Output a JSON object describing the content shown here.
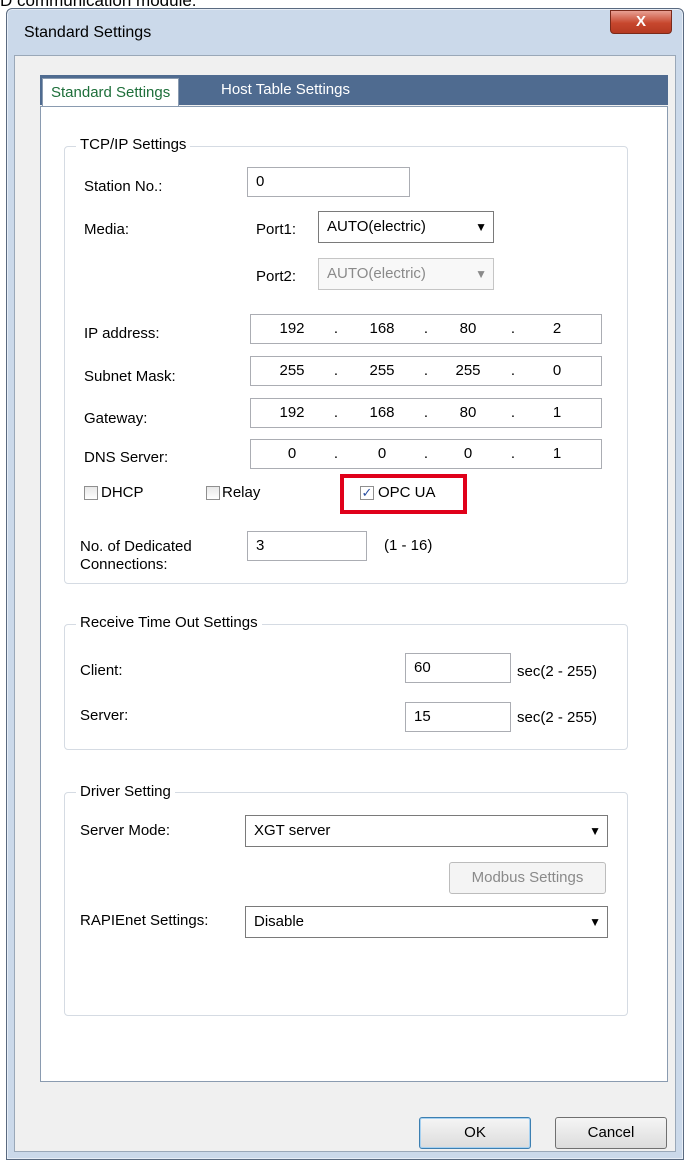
{
  "top_cut_text": "D communication module.",
  "window": {
    "title": "Standard Settings",
    "close_label": "X"
  },
  "tabs": [
    {
      "label": "Standard Settings"
    },
    {
      "label": "Host Table Settings"
    }
  ],
  "tcpip": {
    "group_label": "TCP/IP Settings",
    "station_label": "Station No.:",
    "station_value": "0",
    "media_label": "Media:",
    "port1_label": "Port1:",
    "port1_value": "AUTO(electric)",
    "port2_label": "Port2:",
    "port2_value": "AUTO(electric)",
    "ip_label": "IP address:",
    "ip": [
      "192",
      "168",
      "80",
      "2"
    ],
    "subnet_label": "Subnet Mask:",
    "subnet": [
      "255",
      "255",
      "255",
      "0"
    ],
    "gateway_label": "Gateway:",
    "gateway": [
      "192",
      "168",
      "80",
      "1"
    ],
    "dns_label": "DNS Server:",
    "dns": [
      "0",
      "0",
      "0",
      "1"
    ],
    "dhcp_label": "DHCP",
    "relay_label": "Relay",
    "opcua_label": "OPC UA",
    "dedicated_label_1": "No. of Dedicated",
    "dedicated_label_2": "Connections:",
    "dedicated_value": "3",
    "dedicated_range": "(1 - 16)"
  },
  "timeout": {
    "group_label": "Receive Time Out Settings",
    "client_label": "Client:",
    "client_value": "60",
    "server_label": "Server:",
    "server_value": "15",
    "unit_range": "sec(2 - 255)"
  },
  "driver": {
    "group_label": "Driver Setting",
    "server_mode_label": "Server Mode:",
    "server_mode_value": "XGT server",
    "modbus_button": "Modbus Settings",
    "rapienet_label": "RAPIEnet Settings:",
    "rapienet_value": "Disable"
  },
  "buttons": {
    "ok": "OK",
    "cancel": "Cancel"
  },
  "colors": {
    "highlight": "#e0001a",
    "tab_bar": "#4f6b90",
    "active_tab_text": "#1e6f3a"
  }
}
